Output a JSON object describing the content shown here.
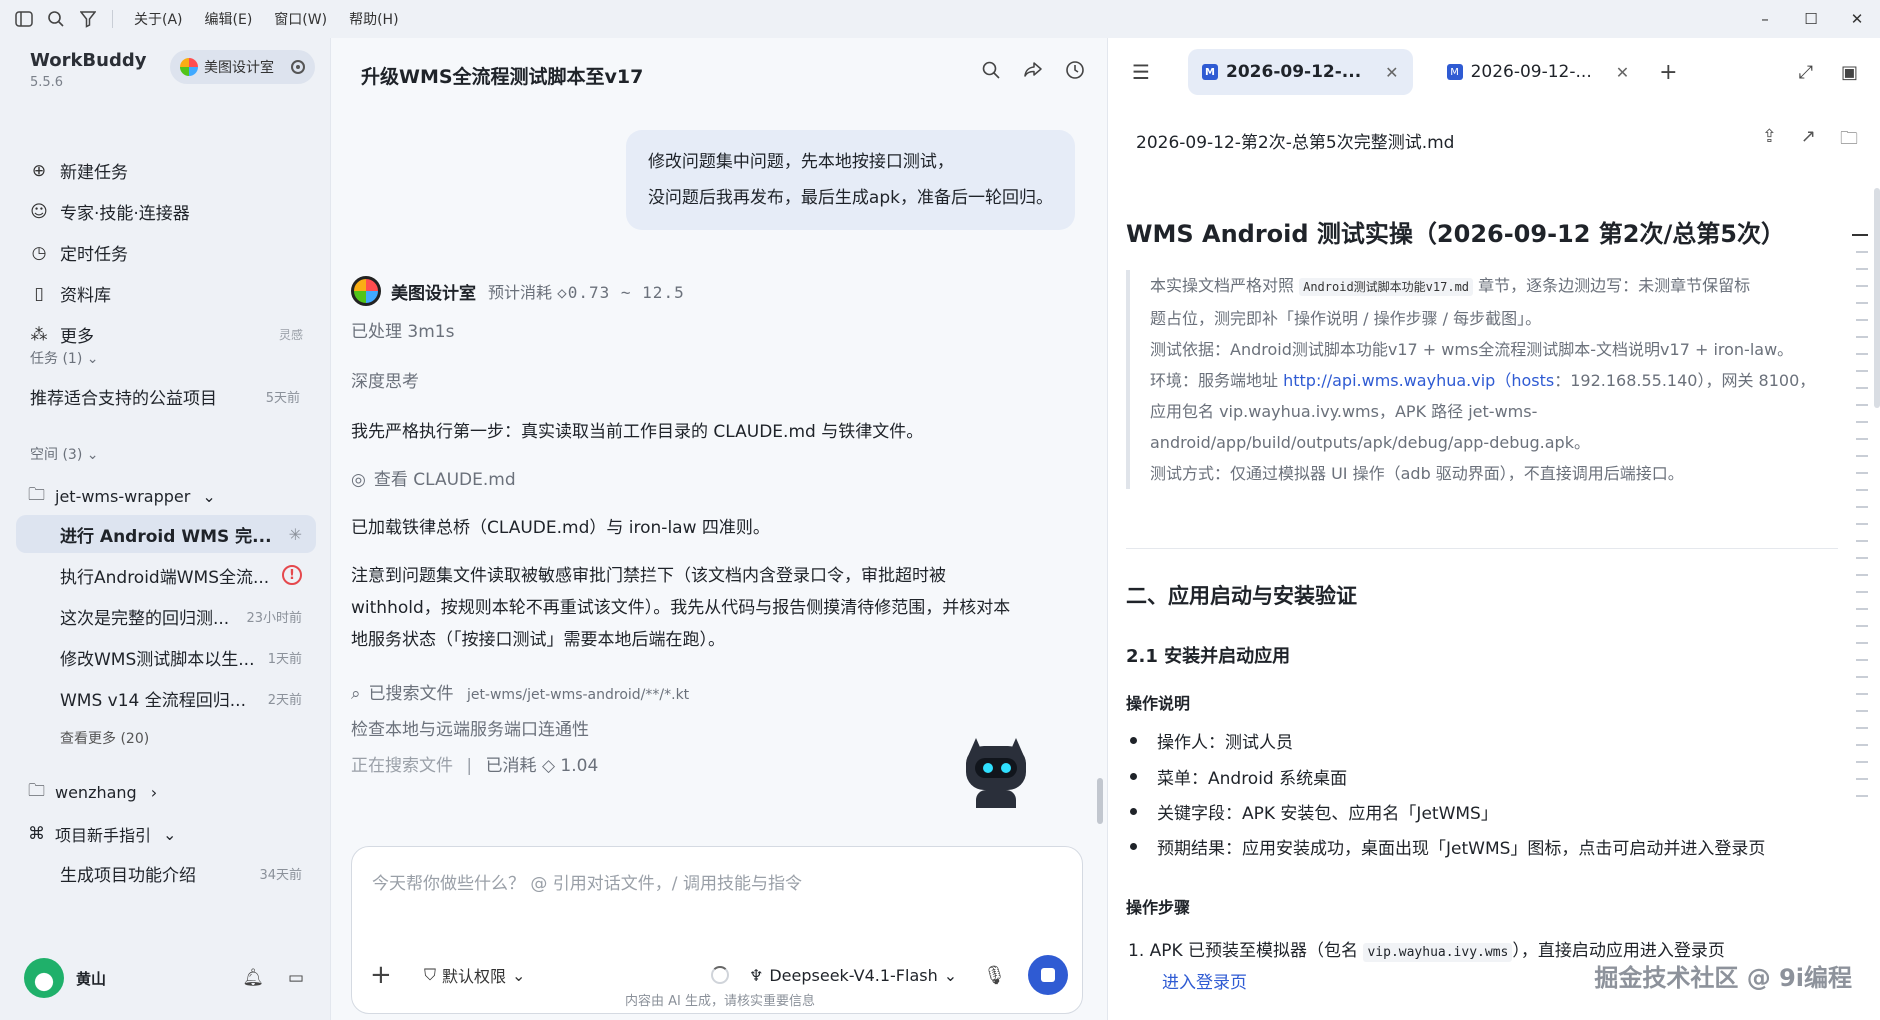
{
  "menubar": {
    "items": [
      "关于(A)",
      "编辑(E)",
      "窗口(W)",
      "帮助(H)"
    ]
  },
  "window_controls": {
    "minimize": "–",
    "maximize": "☐",
    "close": "✕"
  },
  "sidebar": {
    "app_name": "WorkBuddy",
    "version": "5.5.6",
    "org": "美图设计室",
    "nav": [
      {
        "label": "新建任务",
        "icon": "add-task-icon"
      },
      {
        "label": "专家·技能·连接器",
        "icon": "expert-icon"
      },
      {
        "label": "定时任务",
        "icon": "clock-icon"
      },
      {
        "label": "资料库",
        "icon": "book-icon"
      },
      {
        "label": "更多",
        "icon": "grid-icon",
        "hint": "灵感"
      }
    ],
    "tasks_header": "任务 (1)",
    "tasks": [
      {
        "title": "推荐适合支持的公益项目",
        "time": "5天前"
      }
    ],
    "spaces_header": "空间 (3)",
    "space1": {
      "name": "jet-wms-wrapper",
      "items": [
        {
          "title": "进行 Android WMS 完...",
          "status": "running"
        },
        {
          "title": "执行Android端WMS全流...",
          "status": "error"
        },
        {
          "title": "这次是完整的回归测...",
          "time": "23小时前"
        },
        {
          "title": "修改WMS测试脚本以生...",
          "time": "1天前"
        },
        {
          "title": "WMS v14 全流程回归...",
          "time": "2天前"
        }
      ],
      "more": "查看更多 (20)"
    },
    "space2": {
      "name": "wenzhang"
    },
    "space3": {
      "name": "项目新手指引",
      "items": [
        {
          "title": "生成项目功能介绍",
          "time": "34天前"
        }
      ]
    },
    "user": {
      "name": "黄山"
    }
  },
  "chat": {
    "title": "升级WMS全流程测试脚本至v17",
    "user_msg_line1": "修改问题集中问题，先本地按接口测试，",
    "user_msg_line2": "没问题后我再发布，最后生成apk，准备后一轮回归。",
    "ai_name": "美图设计室",
    "estimate_label": "预计消耗",
    "estimate_value": "◇0.73 ~ 12.5",
    "processed": "已处理 3m1s",
    "thinking": "深度思考",
    "p1": "我先严格执行第一步：真实读取当前工作目录的 CLAUDE.md 与铁律文件。",
    "view_file": "查看 CLAUDE.md",
    "p2": "已加载铁律总桥（CLAUDE.md）与 iron-law 四准则。",
    "p3_line1": "注意到问题集文件读取被敏感审批门禁拦下（该文档内含登录口令，审批超时被",
    "p3_line2": "withhold，按规则本轮不再重试该文件）。我先从代码与报告侧摸清待修范围，并核对本",
    "p3_line3": "地服务状态（「按接口测试」需要本地后端在跑）。",
    "searched_label": "已搜索文件",
    "searched_path": "jet-wms/jet-wms-android/**/*.kt",
    "check_ports": "检查本地与远端服务端口连通性",
    "searching": "正在搜索文件",
    "consumed": "已消耗 ◇ 1.04",
    "composer_placeholder": "今天帮你做些什么？ @ 引用对话文件，/ 调用技能与指令",
    "permission": "默认权限",
    "model": "Deepseek-V4.1-Flash",
    "disclaimer": "内容由 AI 生成，请核实重要信息"
  },
  "doc": {
    "tab1": "2026-09-12-...",
    "tab2": "2026-09-12-...",
    "filename": "2026-09-12-第2次-总第5次完整测试.md",
    "h1": "WMS Android 测试实操（2026-09-12 第2次/总第5次）",
    "q1a": "本实操文档严格对照",
    "q1code": "Android测试脚本功能v17.md",
    "q1b": "章节，逐条边测边写：未测章节保留标",
    "q1c": "题占位，测完即补「操作说明 / 操作步骤 / 每步截图」。",
    "q2": "测试依据：Android测试脚本功能v17 + wms全流程测试脚本-文档说明v17 + iron-law。",
    "q3a": "环境：服务端地址",
    "q3link": "http://api.wms.wayhua.vip（hosts",
    "q3b": "：192.168.55.140），网关 8100，",
    "q4": "应用包名 vip.wayhua.ivy.wms，APK 路径 jet-wms-",
    "q5": "android/app/build/outputs/apk/debug/app-debug.apk。",
    "q6": "测试方式：仅通过模拟器 UI 操作（adb 驱动界面），不直接调用后端接口。",
    "h2": "二、应用启动与安装验证",
    "h3": "2.1 安装并启动应用",
    "op_desc": "操作说明",
    "bullets": [
      "操作人：测试人员",
      "菜单：Android 系统桌面",
      "关键字段：APK 安装包、应用名「JetWMS」",
      "预期结果：应用安装成功，桌面出现「JetWMS」图标，点击可启动并进入登录页"
    ],
    "op_steps": "操作步骤",
    "step1a": "1.   APK 已预装至模拟器（包名",
    "step1code": "vip.wayhua.ivy.wms",
    "step1b": "），直接启动应用进入登录页",
    "step1link": "进入登录页",
    "watermark": "掘金技术社区 @ 9i编程"
  }
}
